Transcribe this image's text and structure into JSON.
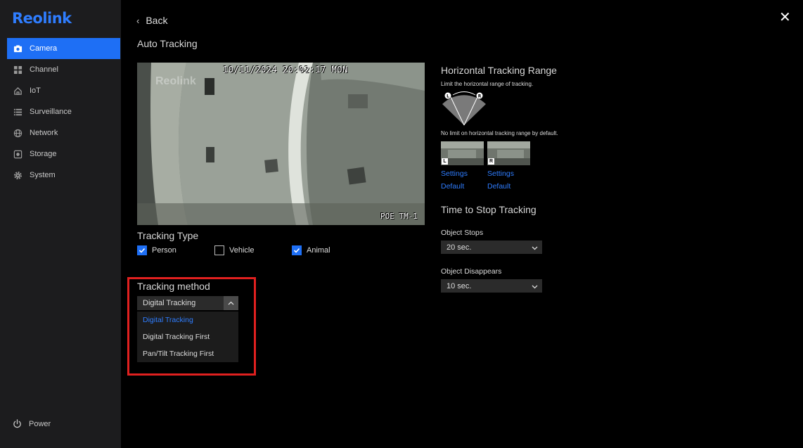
{
  "app": {
    "logo": "Reolink"
  },
  "sidebar": {
    "items": [
      {
        "label": "Camera",
        "icon": "camera-icon",
        "active": true
      },
      {
        "label": "Channel",
        "icon": "grid-icon"
      },
      {
        "label": "IoT",
        "icon": "home-icon"
      },
      {
        "label": "Surveillance",
        "icon": "list-icon"
      },
      {
        "label": "Network",
        "icon": "globe-icon"
      },
      {
        "label": "Storage",
        "icon": "storage-icon"
      },
      {
        "label": "System",
        "icon": "gear-icon"
      }
    ],
    "power_label": "Power"
  },
  "header": {
    "back_label": "Back",
    "title": "Auto Tracking"
  },
  "camera": {
    "timestamp": "10/11/2024 20:02:17 MON",
    "channel_name": "POE TM-1",
    "watermark": "Reolink"
  },
  "tracking_type": {
    "title": "Tracking Type",
    "options": [
      {
        "label": "Person",
        "checked": true
      },
      {
        "label": "Vehicle",
        "checked": false
      },
      {
        "label": "Animal",
        "checked": true
      }
    ]
  },
  "tracking_method": {
    "title": "Tracking method",
    "selected": "Digital Tracking",
    "options": [
      "Digital Tracking",
      "Digital Tracking First",
      "Pan/Tilt Tracking First"
    ]
  },
  "horizontal_range": {
    "title": "Horizontal Tracking Range",
    "description": "Limit the horizontal range of tracking.",
    "note": "No limit on horizontal tracking range by default.",
    "left": {
      "tag": "L",
      "settings_label": "Settings",
      "default_label": "Default"
    },
    "right": {
      "tag": "R",
      "settings_label": "Settings",
      "default_label": "Default"
    }
  },
  "stop_tracking": {
    "title": "Time to Stop Tracking",
    "object_stops_label": "Object Stops",
    "object_stops_value": "20 sec.",
    "object_disappears_label": "Object Disappears",
    "object_disappears_value": "10 sec."
  },
  "colors": {
    "accent": "#1e6ff5",
    "highlight": "#e0201f",
    "sidebar_bg": "#1c1c1e"
  }
}
